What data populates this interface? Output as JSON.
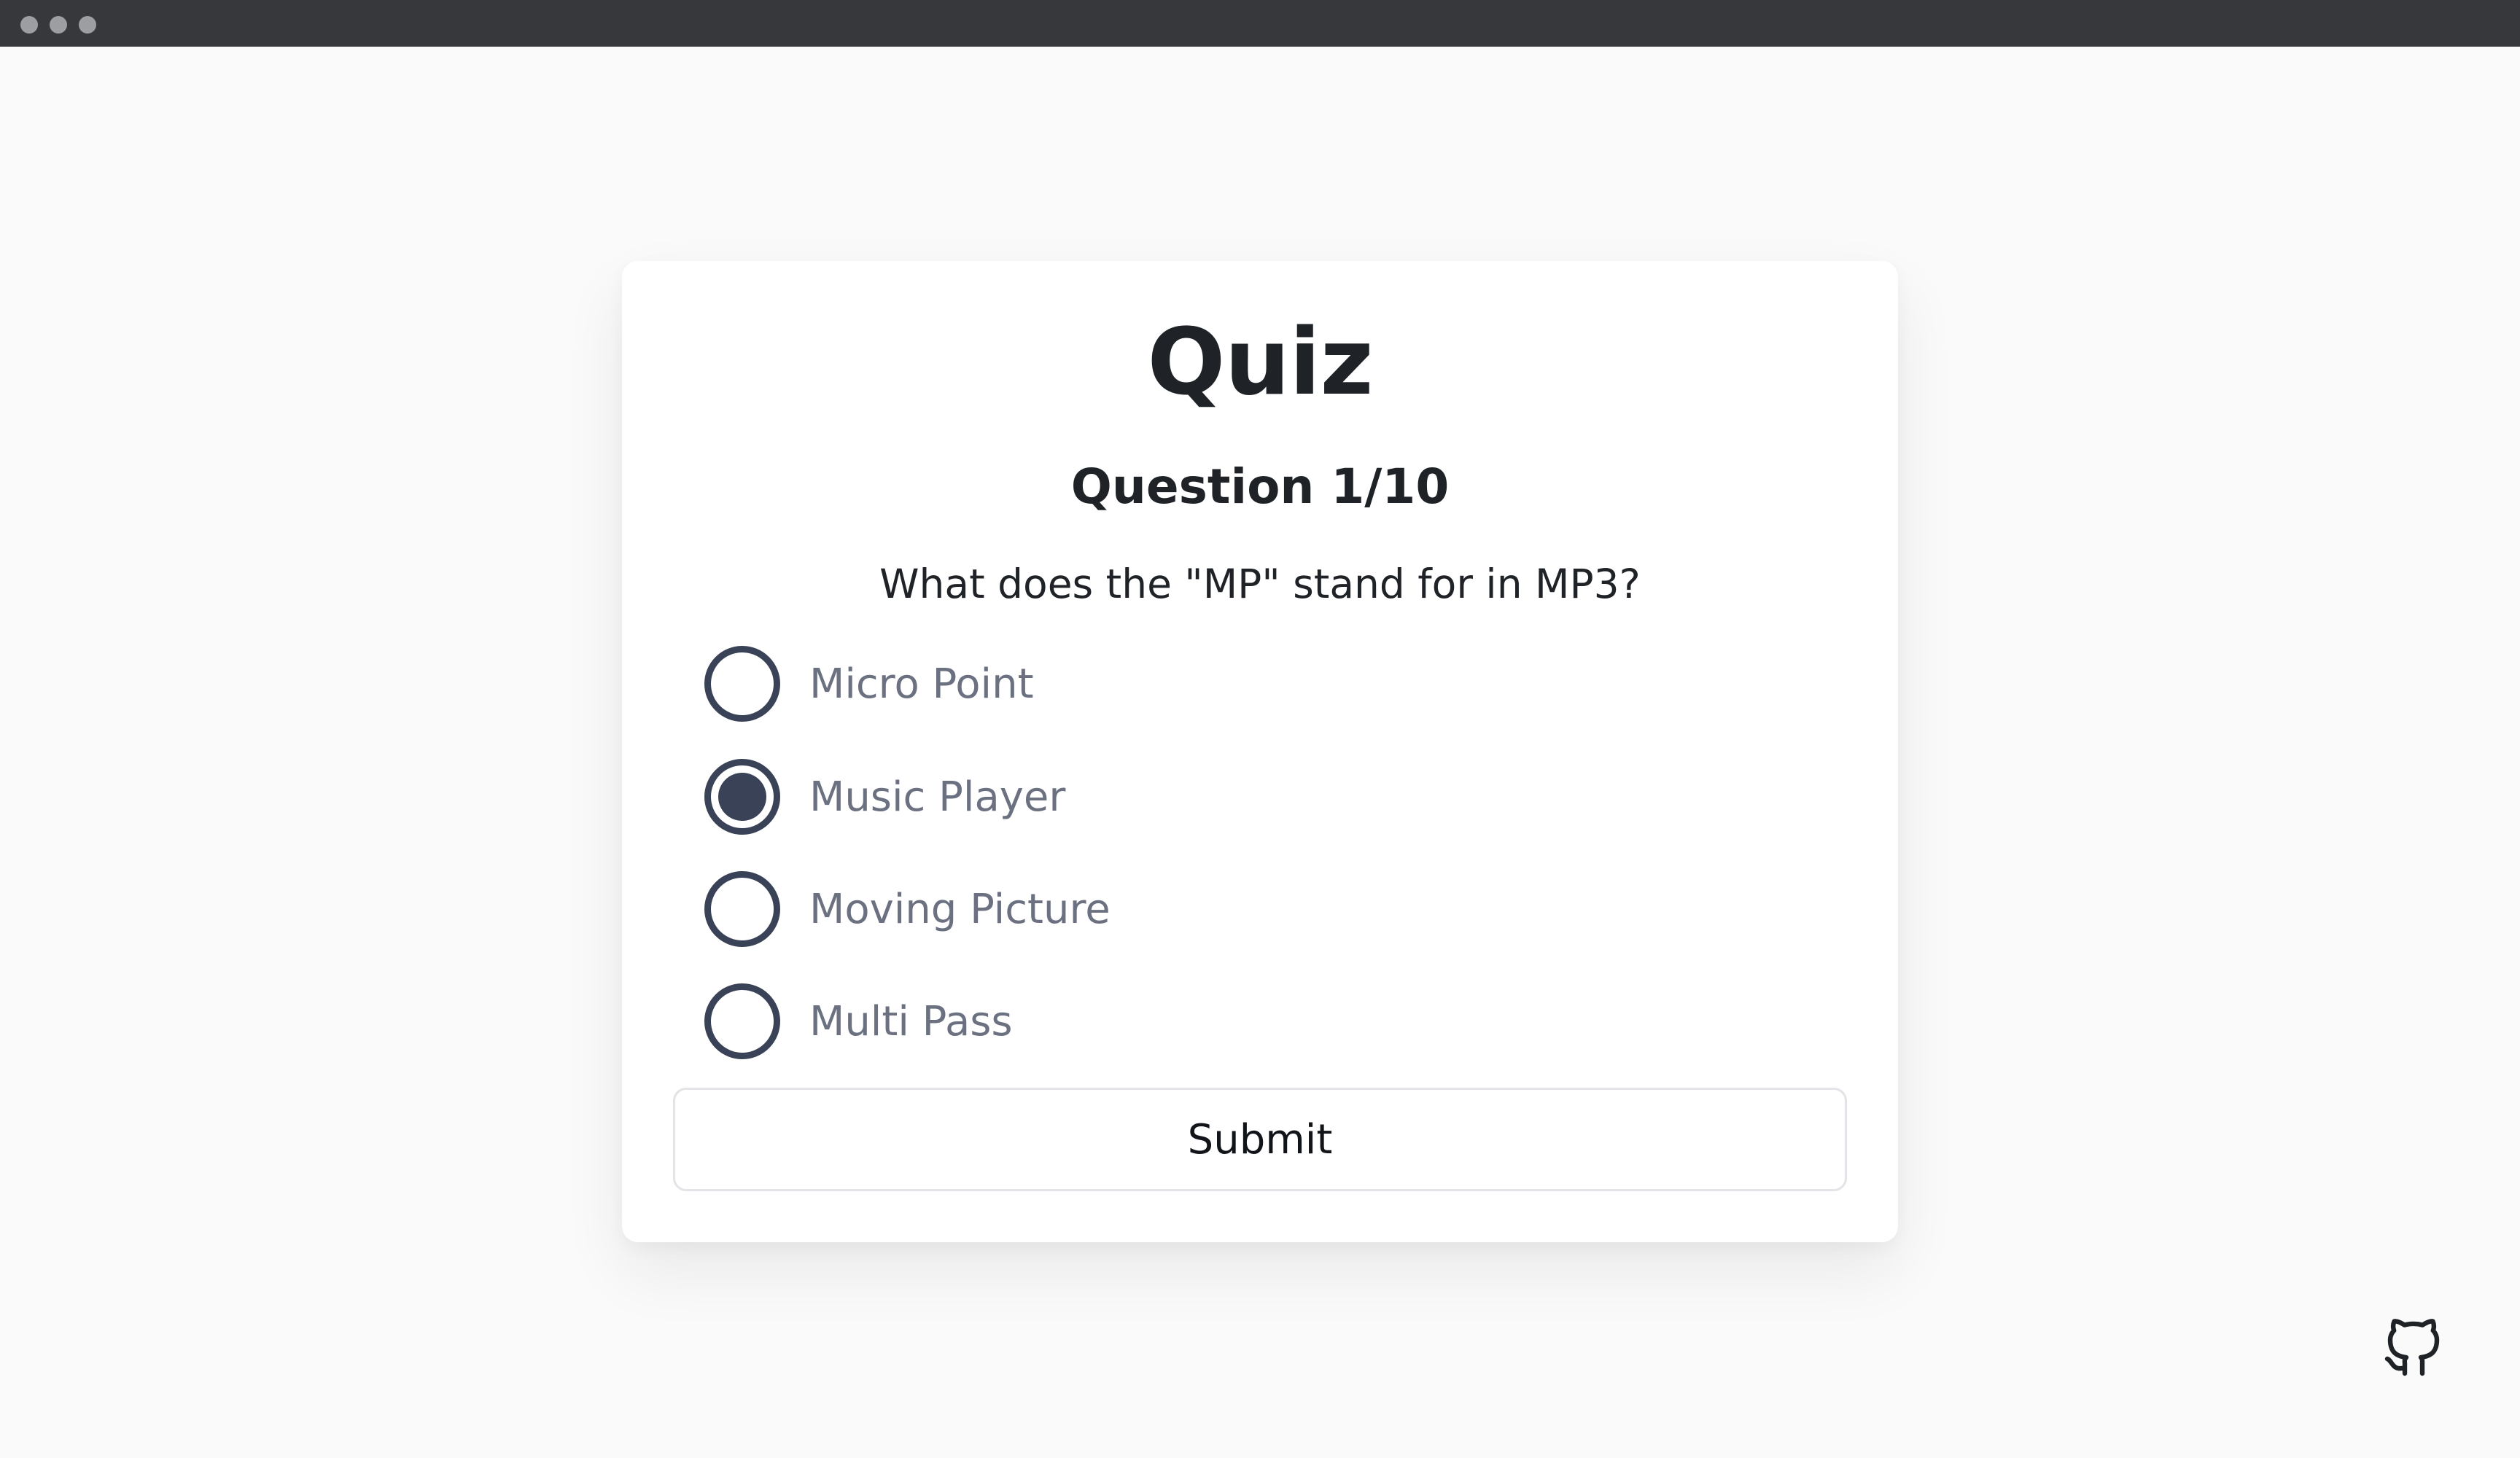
{
  "window": {
    "controls": [
      "window-dot-icon",
      "window-dot-icon",
      "window-dot-icon"
    ]
  },
  "quiz": {
    "title": "Quiz",
    "question_number": "Question 1/10",
    "question": "What does the \"MP\" stand for in MP3?",
    "options": [
      {
        "label": "Micro Point",
        "selected": false
      },
      {
        "label": "Music Player",
        "selected": true
      },
      {
        "label": "Moving Picture",
        "selected": false
      },
      {
        "label": "Multi Pass",
        "selected": false
      }
    ],
    "submit_label": "Submit"
  },
  "footer": {
    "icon": "github-icon"
  },
  "colors": {
    "page_background": "#fafafa",
    "titlebar": "#37383c",
    "radio": "#3a4257",
    "option_text": "#6b7180",
    "heading_text": "#1f2328"
  }
}
